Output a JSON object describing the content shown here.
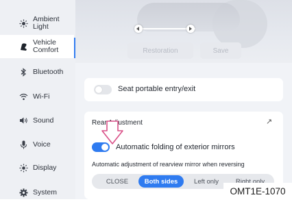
{
  "sidebar": {
    "items": [
      {
        "icon": "sun-icon",
        "label_line1": "Ambient",
        "label_line2": "Light",
        "active": false
      },
      {
        "icon": "seat-icon",
        "label_line1": "Vehicle",
        "label_line2": "Comfort",
        "active": true
      },
      {
        "icon": "bluetooth-icon",
        "label_line1": "Bluetooth",
        "label_line2": "",
        "active": false
      },
      {
        "icon": "wifi-icon",
        "label_line1": "Wi-Fi",
        "label_line2": "",
        "active": false
      },
      {
        "icon": "volume-icon",
        "label_line1": "Sound",
        "label_line2": "",
        "active": false
      },
      {
        "icon": "microphone-icon",
        "label_line1": "Voice",
        "label_line2": "",
        "active": false
      },
      {
        "icon": "brightness-icon",
        "label_line1": "Display",
        "label_line2": "",
        "active": false
      },
      {
        "icon": "gear-icon",
        "label_line1": "System",
        "label_line2": "",
        "active": false
      }
    ]
  },
  "seat_panel": {
    "restoration_label": "Restoration",
    "save_label": "Save"
  },
  "seat_portable": {
    "label": "Seat portable entry/exit",
    "enabled": false
  },
  "rearview": {
    "title": "Rear     Adjustment",
    "auto_fold_label": "Automatic folding of exterior mirrors",
    "auto_fold_enabled": true,
    "reverse_label": "Automatic adjustment of rearview mirror when reversing",
    "options": [
      "CLOSE",
      "Both sides",
      "Left only",
      "Right only"
    ],
    "selected": "Both sides"
  },
  "figure_code": "OMT1E-1070",
  "colors": {
    "accent": "#2f7bf0",
    "sidebar_bg": "#eef0f4",
    "main_bg": "#f1f3f7"
  }
}
